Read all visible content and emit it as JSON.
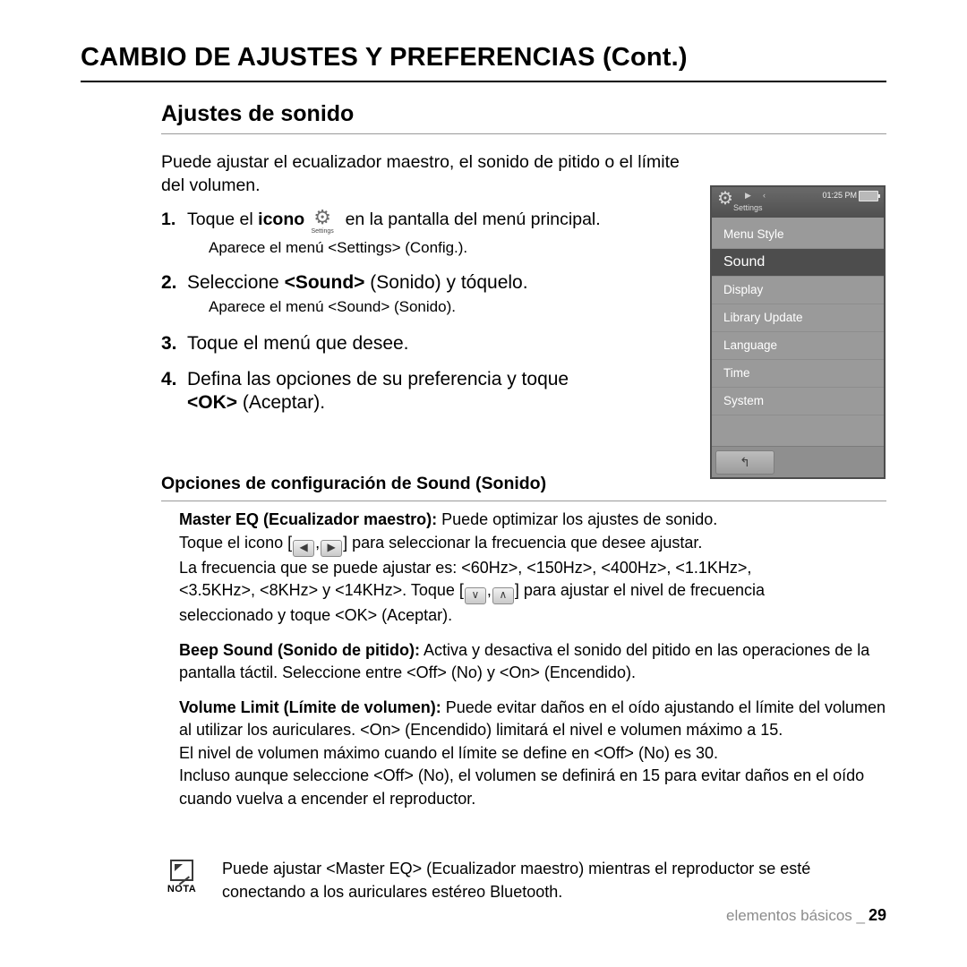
{
  "header": {
    "title": "CAMBIO DE AJUSTES Y PREFERENCIAS (Cont.)"
  },
  "section": {
    "title": "Ajustes de sonido",
    "intro": "Puede ajustar el ecualizador maestro, el sonido de pitido o el límite del volumen."
  },
  "steps": [
    {
      "num": "1.",
      "text_before": "Toque el ",
      "bold": "icono",
      "text_after": " en la pantalla del menú principal.",
      "icon_label": "Settings",
      "sub": "Aparece el menú <Settings> (Config.)."
    },
    {
      "num": "2.",
      "text_before": "Seleccione ",
      "bold": "<Sound>",
      "text_after": " (Sonido) y tóquelo.",
      "sub": "Aparece el menú <Sound> (Sonido)."
    },
    {
      "num": "3.",
      "text_before": "Toque el menú que desee.",
      "bold": "",
      "text_after": "",
      "sub": ""
    },
    {
      "num": "4.",
      "text_before": "Defina las opciones de su preferencia y toque ",
      "bold": "<OK>",
      "text_after": " (Aceptar).",
      "sub": ""
    }
  ],
  "device": {
    "status": {
      "title": "Settings",
      "time": "01:25 PM"
    },
    "menu": [
      "Menu Style",
      "Sound",
      "Display",
      "Library Update",
      "Language",
      "Time",
      "System"
    ],
    "selected": "Sound",
    "back_label": "↰"
  },
  "options": {
    "heading": "Opciones de configuración de Sound (Sonido)",
    "blocks": [
      {
        "title": "Master EQ (Ecualizador maestro):",
        "line1_rest": " Puede optimizar los ajustes de sonido.",
        "line2_a": "Toque el icono [",
        "key1": "◀",
        "sep1": ",",
        "key2": "▶",
        "line2_b": "] para seleccionar la frecuencia que desee ajustar.",
        "line3": "La frecuencia que se puede ajustar es: <60Hz>, <150Hz>, <400Hz>, <1.1KHz>,",
        "line4_a": "<3.5KHz>, <8KHz> y <14KHz>. Toque [",
        "key3": "∨",
        "sep2": ",",
        "key4": "∧",
        "line4_b": "] para ajustar el nivel de frecuencia",
        "line5": "seleccionado y toque <OK> (Aceptar)."
      },
      {
        "title": "Beep Sound (Sonido de pitido):",
        "text": " Activa y desactiva el sonido del pitido en las operaciones de la pantalla táctil. Seleccione entre <Off> (No) y <On> (Encendido)."
      },
      {
        "title": "Volume Limit (Límite de volumen):",
        "text": " Puede evitar daños en el oído ajustando el límite del volumen al utilizar los auriculares. <On> (Encendido) limitará el nivel e volumen máximo a 15.",
        "extra1": "El nivel de volumen máximo cuando el límite se define en <Off> (No) es 30.",
        "extra2": "Incluso aunque seleccione <Off> (No), el volumen se definirá en 15 para evitar daños en el oído cuando vuelva a encender el reproductor."
      }
    ]
  },
  "note": {
    "label": "NOTA",
    "text": "Puede ajustar <Master EQ> (Ecualizador maestro) mientras el reproductor se esté conectando a los auriculares estéreo Bluetooth."
  },
  "footer": {
    "label": "elementos básicos _",
    "page": "29"
  }
}
